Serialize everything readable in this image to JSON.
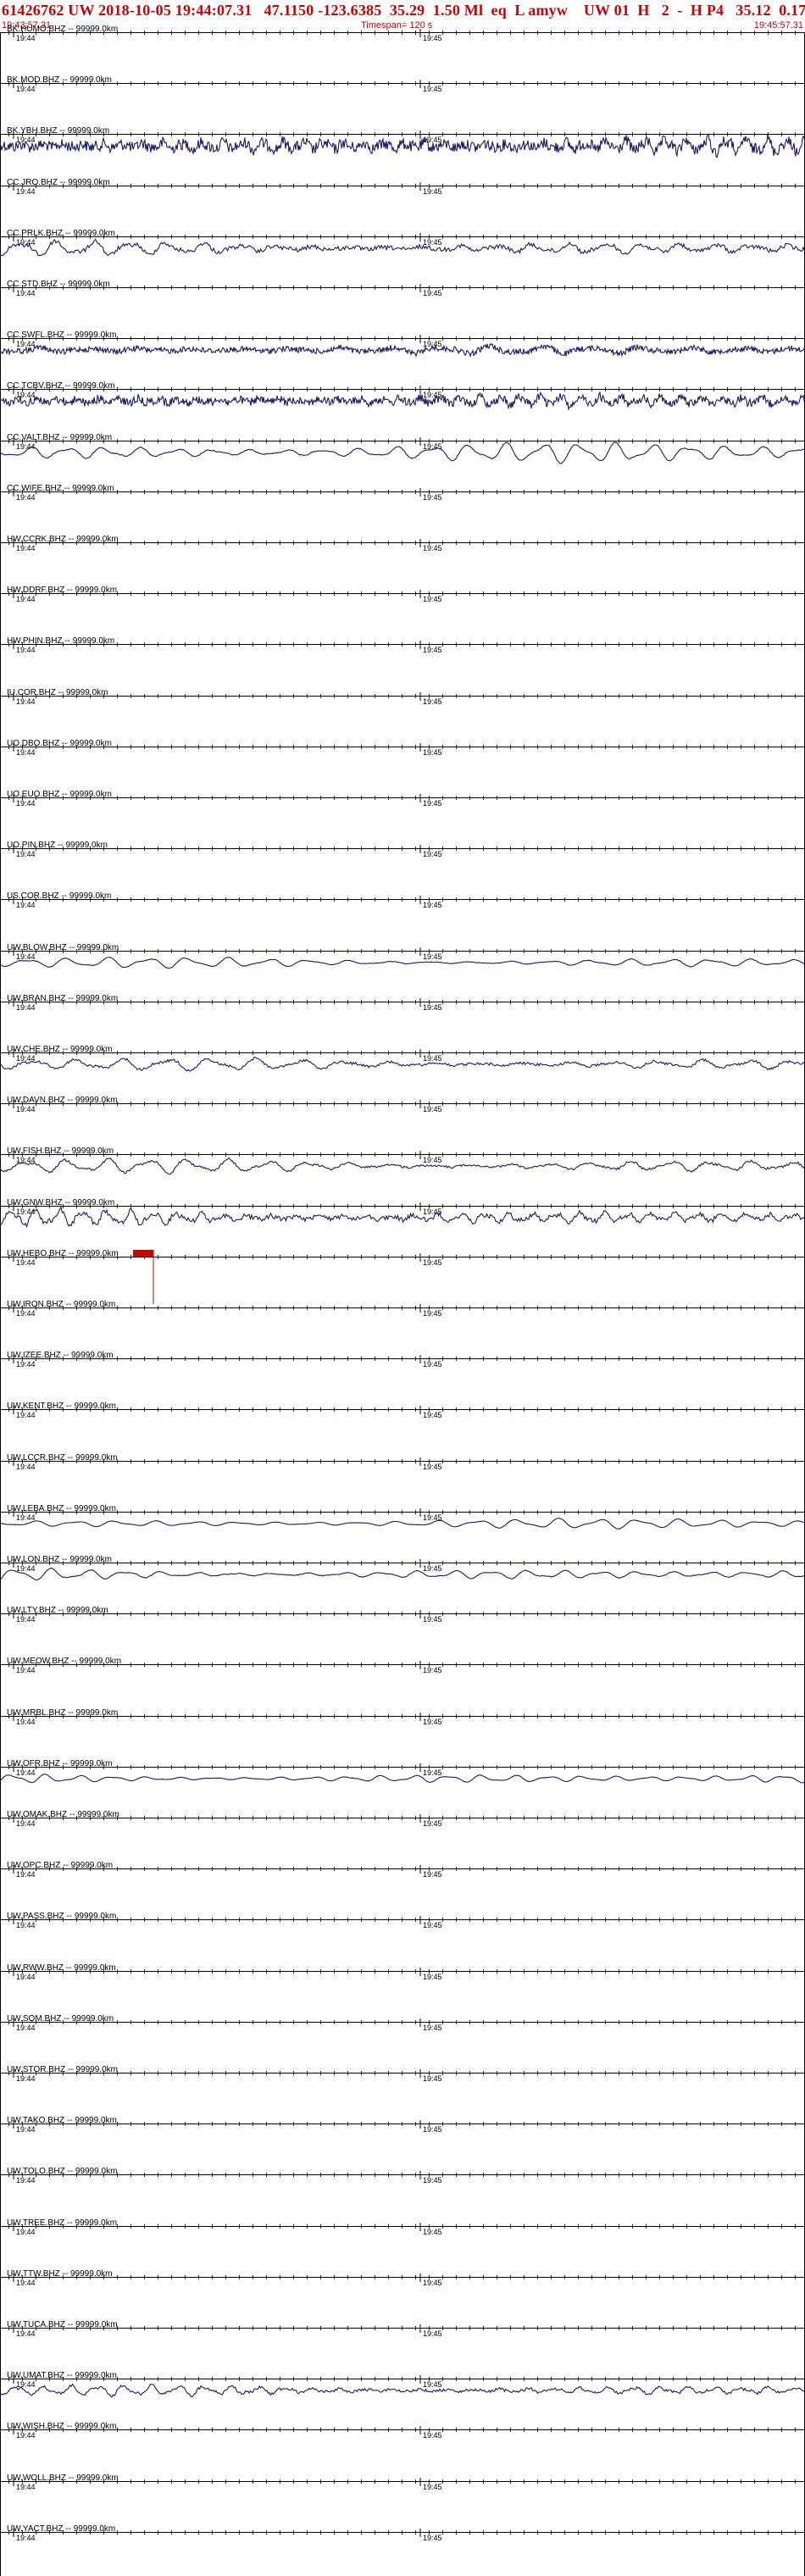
{
  "header": {
    "title": "61426762 UW 2018-10-05 19:44:07.31   47.1150 -123.6385  35.29  1.50 Ml  eq  L amyw    UW 01  H   2  -  H P4   35.12  0.17",
    "start_time": "19:43:57.31",
    "timespan": "Timespan= 120 s",
    "end_time": "19:45:57.31"
  },
  "time_labels": {
    "first": "19:44",
    "second": "19:45"
  },
  "colors": {
    "trace": "#1a1a66",
    "header_text": "#cc0000",
    "pick_marker": "#cc0000",
    "axis": "#000000"
  },
  "pick_marker": {
    "label": "",
    "channel_index": 24
  },
  "channels": [
    {
      "label": "BK.HUMO.BHZ -- 99999.0km",
      "amplitude": 0,
      "frequency": 0,
      "noise": 0
    },
    {
      "label": "BK.MOD.BHZ -- 99999.0km",
      "amplitude": 0,
      "frequency": 0,
      "noise": 0
    },
    {
      "label": "BK.YBH.BHZ -- 99999.0km",
      "amplitude": 0.7,
      "frequency": 40,
      "noise": 0.9
    },
    {
      "label": "CC.JRO.BHZ -- 99999.0km",
      "amplitude": 0,
      "frequency": 0,
      "noise": 0
    },
    {
      "label": "CC.PRLK.BHZ -- 99999.0km",
      "amplitude": 0.8,
      "frequency": 22,
      "noise": 0.3
    },
    {
      "label": "CC.STD.BHZ -- 99999.0km",
      "amplitude": 0,
      "frequency": 0,
      "noise": 0
    },
    {
      "label": "CC.SWFL.BHZ -- 99999.0km",
      "amplitude": 0.4,
      "frequency": 16,
      "noise": 0.8
    },
    {
      "label": "CC.TCBV.BHZ -- 99999.0km",
      "amplitude": 0.5,
      "frequency": 40,
      "noise": 0.9
    },
    {
      "label": "CC.VALT.BHZ -- 99999.0km",
      "amplitude": 1.0,
      "frequency": 22,
      "noise": 0.05
    },
    {
      "label": "CC.WIFE.BHZ -- 99999.0km",
      "amplitude": 0,
      "frequency": 0,
      "noise": 0
    },
    {
      "label": "HW.CCRK.BHZ -- 99999.0km",
      "amplitude": 0,
      "frequency": 0,
      "noise": 0
    },
    {
      "label": "HW.DDRF.BHZ -- 99999.0km",
      "amplitude": 0,
      "frequency": 0,
      "noise": 0
    },
    {
      "label": "HW.PHIN.BHZ -- 99999.0km",
      "amplitude": 0,
      "frequency": 0,
      "noise": 0
    },
    {
      "label": "IU.COR.BHZ -- 99999.0km",
      "amplitude": 0,
      "frequency": 0,
      "noise": 0
    },
    {
      "label": "UO.DBO.BHZ -- 99999.0km",
      "amplitude": 0,
      "frequency": 0,
      "noise": 0
    },
    {
      "label": "UO.EUO.BHZ -- 99999.0km",
      "amplitude": 0,
      "frequency": 0,
      "noise": 0
    },
    {
      "label": "UO.PIN.BHZ -- 99999.0km",
      "amplitude": 0,
      "frequency": 0,
      "noise": 0
    },
    {
      "label": "US.COR.BHZ -- 99999.0km",
      "amplitude": 0,
      "frequency": 0,
      "noise": 0
    },
    {
      "label": "UW.BLOW.BHZ -- 99999.0km",
      "amplitude": 0.6,
      "frequency": 20,
      "noise": 0.05
    },
    {
      "label": "UW.BRAN.BHZ -- 99999.0km",
      "amplitude": 0,
      "frequency": 0,
      "noise": 0
    },
    {
      "label": "UW.CHE.BHZ -- 99999.0km",
      "amplitude": 0.7,
      "frequency": 18,
      "noise": 0.2
    },
    {
      "label": "UW.DAVN.BHZ -- 99999.0km",
      "amplitude": 0,
      "frequency": 0,
      "noise": 0
    },
    {
      "label": "UW.FISH.BHZ -- 99999.0km",
      "amplitude": 0.8,
      "frequency": 20,
      "noise": 0.15
    },
    {
      "label": "UW.GNW.BHZ -- 99999.0km",
      "amplitude": 0.9,
      "frequency": 34,
      "noise": 0.3
    },
    {
      "label": "UW.HEBO.BHZ -- 99999.0km",
      "amplitude": 0,
      "frequency": 0,
      "noise": 0
    },
    {
      "label": "UW.IRON.BHZ -- 99999.0km",
      "amplitude": 0,
      "frequency": 0,
      "noise": 0
    },
    {
      "label": "UW.IZEE.BHZ -- 99999.0km",
      "amplitude": 0,
      "frequency": 0,
      "noise": 0
    },
    {
      "label": "UW.KENT.BHZ -- 99999.0km",
      "amplitude": 0,
      "frequency": 0,
      "noise": 0
    },
    {
      "label": "UW.LCCR.BHZ -- 99999.0km",
      "amplitude": 0,
      "frequency": 0,
      "noise": 0
    },
    {
      "label": "UW.LEBA.BHZ -- 99999.0km",
      "amplitude": 0.5,
      "frequency": 20,
      "noise": 0.02
    },
    {
      "label": "UW.LON.BHZ -- 99999.0km",
      "amplitude": 0.7,
      "frequency": 22,
      "noise": 0.05
    },
    {
      "label": "UW.LTY.BHZ -- 99999.0km",
      "amplitude": 0,
      "frequency": 0,
      "noise": 0
    },
    {
      "label": "UW.MEOW.BHZ -- 99999.0km",
      "amplitude": 0,
      "frequency": 0,
      "noise": 0
    },
    {
      "label": "UW.MRBL.BHZ -- 99999.0km",
      "amplitude": 0,
      "frequency": 0,
      "noise": 0
    },
    {
      "label": "UW.OFR.BHZ -- 99999.0km",
      "amplitude": 0.6,
      "frequency": 24,
      "noise": 0.03
    },
    {
      "label": "UW.OMAK.BHZ -- 99999.0km",
      "amplitude": 0,
      "frequency": 0,
      "noise": 0
    },
    {
      "label": "UW.OPC.BHZ -- 99999.0km",
      "amplitude": 0,
      "frequency": 0,
      "noise": 0
    },
    {
      "label": "UW.PASS.BHZ -- 99999.0km",
      "amplitude": 0,
      "frequency": 0,
      "noise": 0
    },
    {
      "label": "UW.RWW.BHZ -- 99999.0km",
      "amplitude": 0,
      "frequency": 0,
      "noise": 0
    },
    {
      "label": "UW.SQM.BHZ -- 99999.0km",
      "amplitude": 0,
      "frequency": 0,
      "noise": 0
    },
    {
      "label": "UW.STOR.BHZ -- 99999.0km",
      "amplitude": 0,
      "frequency": 0,
      "noise": 0
    },
    {
      "label": "UW.TAKO.BHZ -- 99999.0km",
      "amplitude": 0,
      "frequency": 0,
      "noise": 0
    },
    {
      "label": "UW.TOLO.BHZ -- 99999.0km",
      "amplitude": 0,
      "frequency": 0,
      "noise": 0
    },
    {
      "label": "UW.TREE.BHZ -- 99999.0km",
      "amplitude": 0,
      "frequency": 0,
      "noise": 0
    },
    {
      "label": "UW.TTW.BHZ -- 99999.0km",
      "amplitude": 0,
      "frequency": 0,
      "noise": 0
    },
    {
      "label": "UW.TUCA.BHZ -- 99999.0km",
      "amplitude": 0,
      "frequency": 0,
      "noise": 0
    },
    {
      "label": "UW.UMAT.BHZ -- 99999.0km",
      "amplitude": 0.6,
      "frequency": 30,
      "noise": 0.25
    },
    {
      "label": "UW.WISH.BHZ -- 99999.0km",
      "amplitude": 0,
      "frequency": 0,
      "noise": 0
    },
    {
      "label": "UW.WOLL.BHZ -- 99999.0km",
      "amplitude": 0,
      "frequency": 0,
      "noise": 0
    },
    {
      "label": "UW.YACT.BHZ -- 99999.0km",
      "amplitude": 0,
      "frequency": 0,
      "noise": 0
    }
  ]
}
